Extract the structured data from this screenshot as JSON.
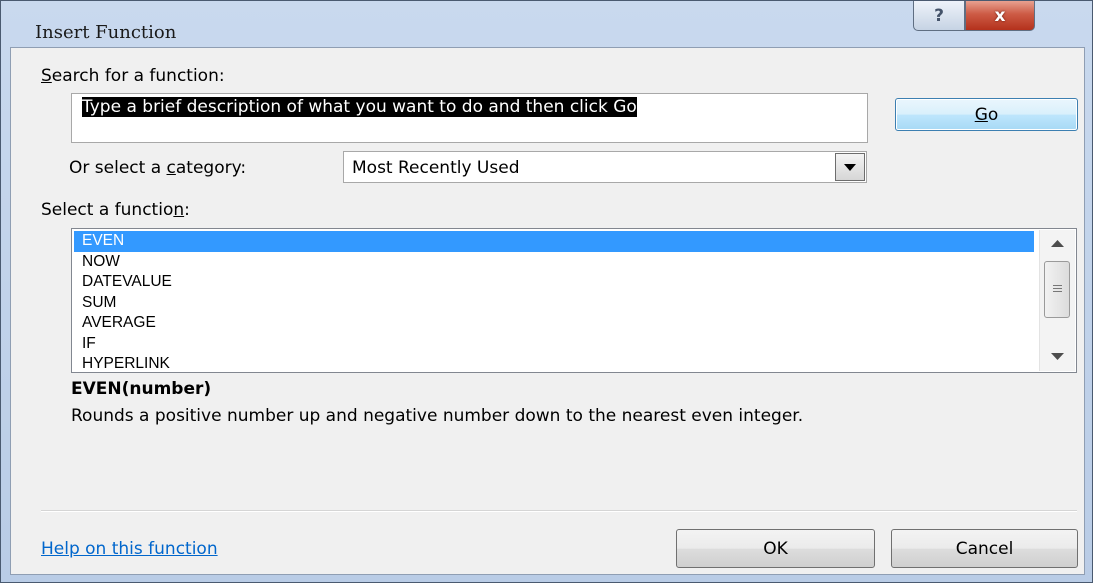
{
  "window": {
    "title": "Insert Function",
    "help_glyph": "?",
    "close_glyph": "x"
  },
  "search": {
    "label": "Search for a function:",
    "value": "Type a brief description of what you want to do and then click Go",
    "go_label": "Go"
  },
  "category": {
    "label": "Or select a category:",
    "selected": "Most Recently Used"
  },
  "functions": {
    "label": "Select a function:",
    "items": [
      "EVEN",
      "NOW",
      "DATEVALUE",
      "SUM",
      "AVERAGE",
      "IF",
      "HYPERLINK"
    ],
    "selected_index": 0
  },
  "details": {
    "signature": "EVEN(number)",
    "description": "Rounds a positive number up and negative number down to the nearest even integer."
  },
  "footer": {
    "help_link": "Help on this function",
    "ok_label": "OK",
    "cancel_label": "Cancel"
  },
  "colors": {
    "selection": "#3399ff",
    "link": "#0066cc",
    "close_button": "#c44a33"
  },
  "icons": {
    "help": "question-mark-icon",
    "close": "close-x-icon",
    "dropdown": "chevron-down-icon",
    "scroll_up": "scroll-up-arrow-icon",
    "scroll_down": "scroll-down-arrow-icon"
  }
}
